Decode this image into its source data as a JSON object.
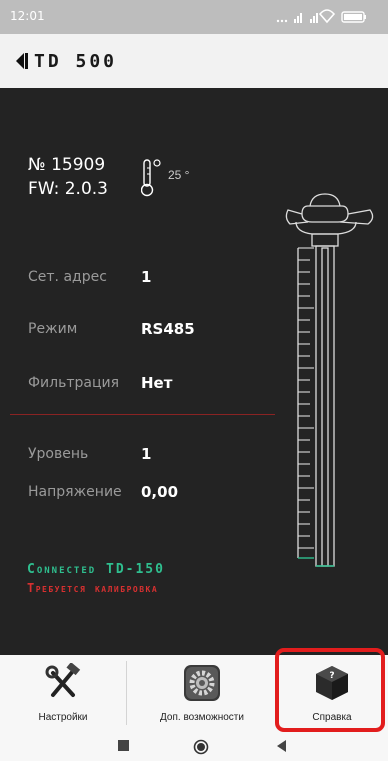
{
  "status_bar": {
    "time": "12:01"
  },
  "app_bar": {
    "title": "TD 500"
  },
  "device": {
    "serial": "№ 15909",
    "firmware": "FW: 2.0.3",
    "temperature": "25 °"
  },
  "params": [
    {
      "label": "Сет. адрес",
      "value": "1"
    },
    {
      "label": "Режим",
      "value": "RS485"
    },
    {
      "label": "Фильтрация",
      "value": "Нет"
    },
    {
      "label": "Уровень",
      "value": "1"
    },
    {
      "label": "Напряжение",
      "value": "0,00"
    }
  ],
  "status": {
    "connected": "Connected TD-150",
    "calibration": "Требуется калибровка"
  },
  "bottom_nav": [
    {
      "label": "Настройки",
      "icon": "settings-tools-icon"
    },
    {
      "label": "Доп. возможности",
      "icon": "gear-icon"
    },
    {
      "label": "Справка",
      "icon": "help-box-icon"
    }
  ],
  "colors": {
    "background": "#232323",
    "connected": "#2fbf8f",
    "warning": "#d83030",
    "highlight": "#e21d1d"
  }
}
